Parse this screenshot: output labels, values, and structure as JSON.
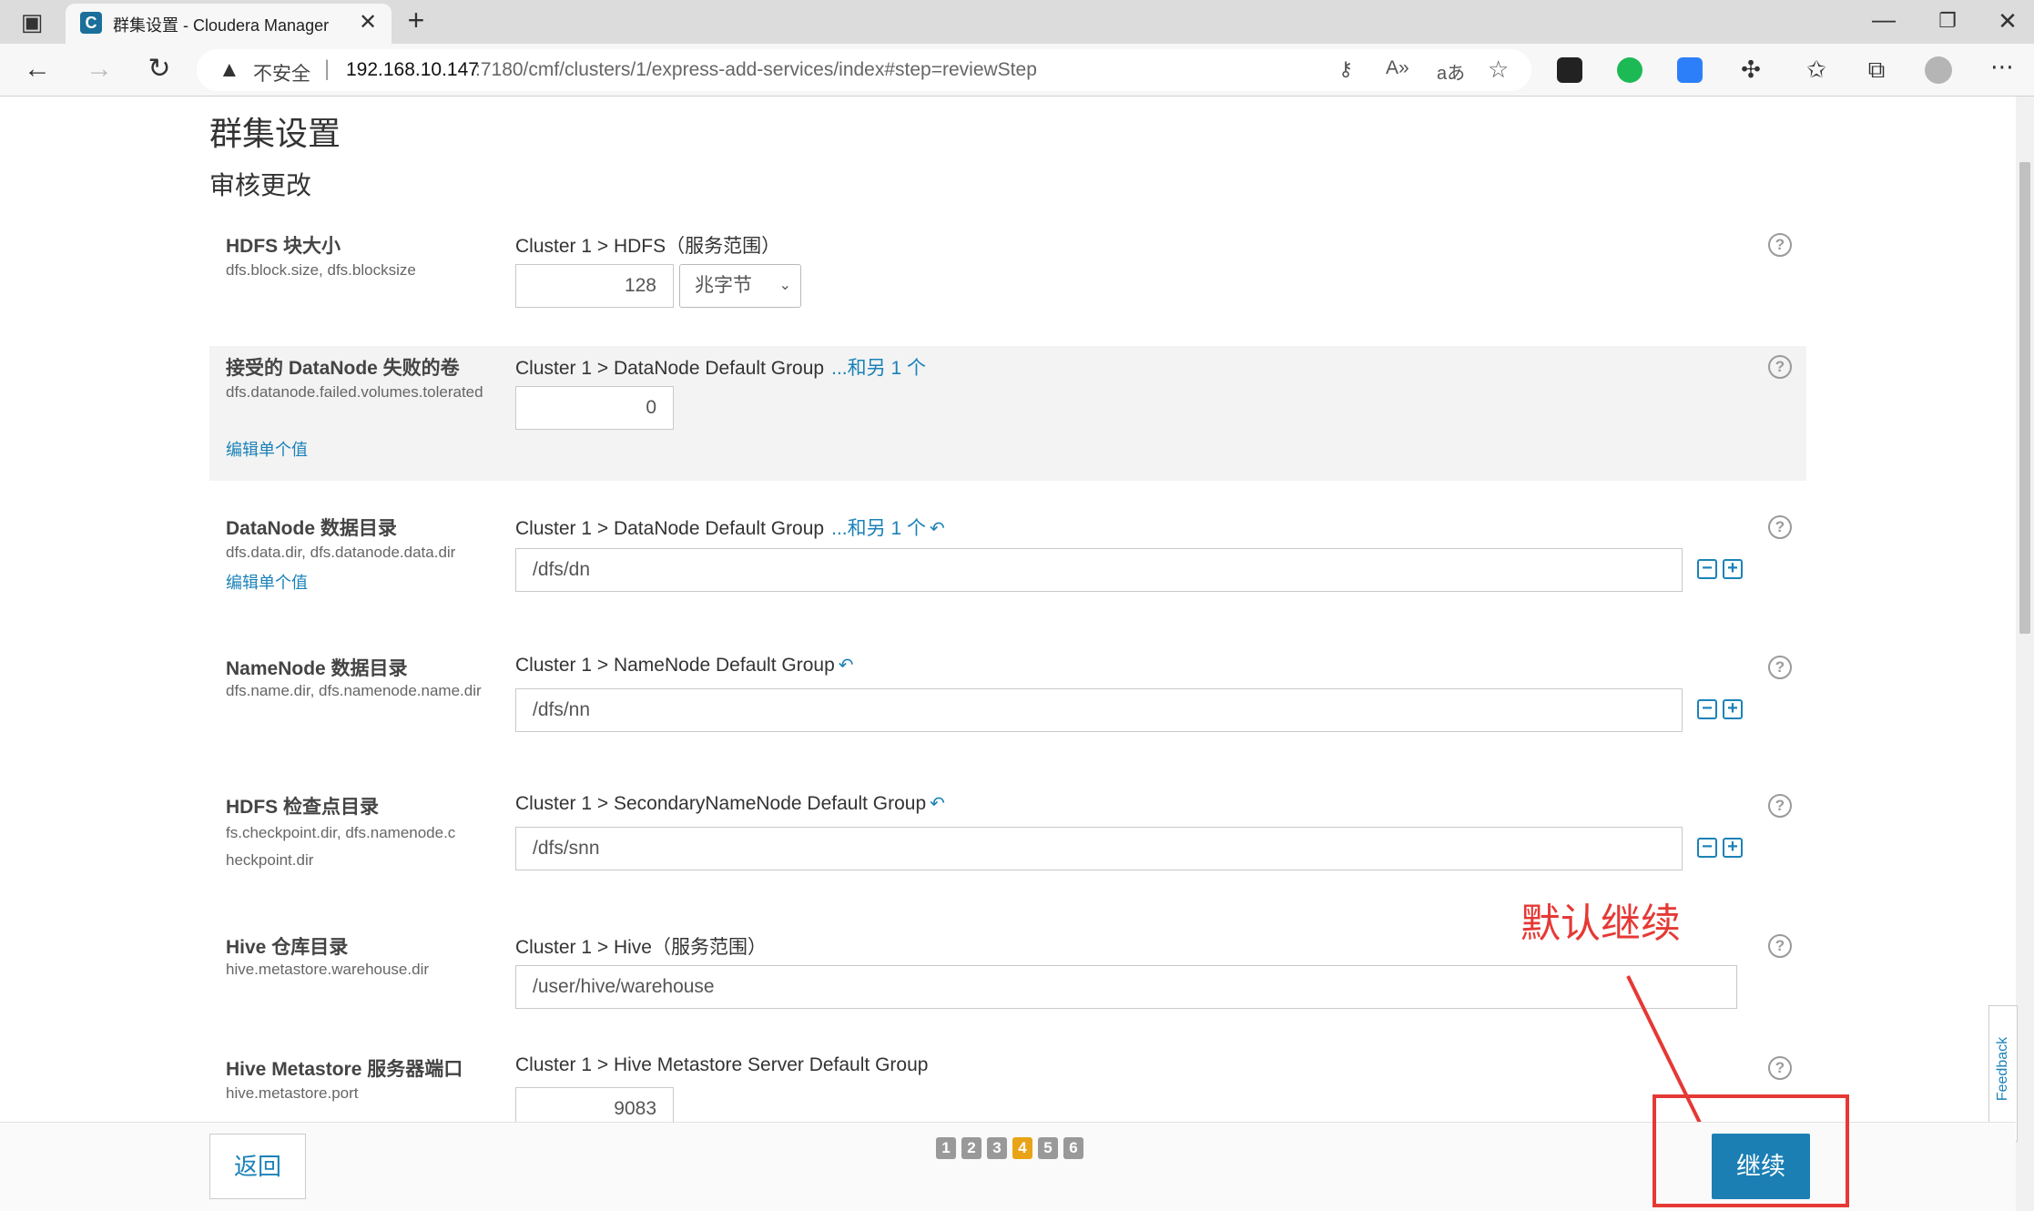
{
  "browser": {
    "tab_title": "群集设置 - Cloudera Manager",
    "insecure_label": "不安全",
    "url_host": "192.168.10.147",
    "url_path": ":7180/cmf/clusters/1/express-add-services/index#step=reviewStep"
  },
  "page": {
    "title": "群集设置",
    "subtitle": "审核更改"
  },
  "rows": {
    "block_size": {
      "label": "HDFS 块大小",
      "key": "dfs.block.size, dfs.blocksize",
      "scope": "Cluster 1 > HDFS（服务范围）",
      "value": "128",
      "unit": "兆字节"
    },
    "failed_volumes": {
      "label": "接受的 DataNode 失败的卷",
      "key": "dfs.datanode.failed.volumes.tolerated",
      "edit": "编辑单个值",
      "scope": "Cluster 1 > DataNode Default Group",
      "more": "...和另 1 个",
      "value": "0"
    },
    "dn_dir": {
      "label": "DataNode 数据目录",
      "key": "dfs.data.dir, dfs.datanode.data.dir",
      "edit": "编辑单个值",
      "scope": "Cluster 1 > DataNode Default Group",
      "more": "...和另 1 个",
      "value": "/dfs/dn"
    },
    "nn_dir": {
      "label": "NameNode 数据目录",
      "key": "dfs.name.dir, dfs.namenode.name.dir",
      "scope": "Cluster 1 > NameNode Default Group",
      "value": "/dfs/nn"
    },
    "checkpoint_dir": {
      "label": "HDFS 检查点目录",
      "key": "fs.checkpoint.dir, dfs.namenode.checkpoint.dir",
      "scope": "Cluster 1 > SecondaryNameNode Default Group",
      "value": "/dfs/snn"
    },
    "hive_warehouse": {
      "label": "Hive 仓库目录",
      "key": "hive.metastore.warehouse.dir",
      "scope": "Cluster 1 > Hive（服务范围）",
      "value": "/user/hive/warehouse"
    },
    "metastore_port": {
      "label": "Hive Metastore 服务器端口",
      "key": "hive.metastore.port",
      "scope": "Cluster 1 > Hive Metastore Server Default Group",
      "value": "9083"
    }
  },
  "footer": {
    "back": "返回",
    "continue": "继续",
    "steps": [
      "1",
      "2",
      "3",
      "4",
      "5",
      "6"
    ],
    "active_step": "4"
  },
  "feedback": "Feedback",
  "annotation": "默认继续",
  "colors": {
    "link": "#1b82b8",
    "primary": "#1b7fb4",
    "active_step": "#e8a317",
    "annotation": "#e53935"
  }
}
